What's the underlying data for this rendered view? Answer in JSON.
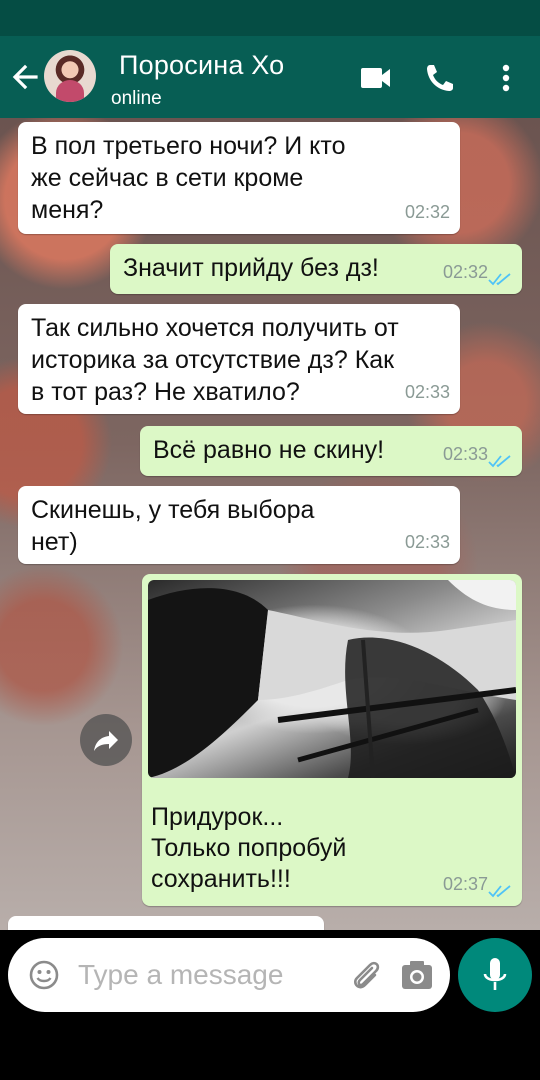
{
  "header": {
    "contact_name": "Поросина Хо",
    "status": "online",
    "back_icon": "arrow-left-icon",
    "actions": [
      "video-call-icon",
      "phone-icon",
      "more-vert-icon"
    ]
  },
  "messages": [
    {
      "direction": "incoming",
      "lines": [
        "В пол третьего ночи? И кто",
        "же сейчас в сети кроме",
        "меня?"
      ],
      "time": "02:32"
    },
    {
      "direction": "outgoing",
      "lines": [
        "Значит прийду без дз!"
      ],
      "time": "02:32",
      "read": true
    },
    {
      "direction": "incoming",
      "lines": [
        "Так сильно хочется получить от",
        "историка за отсутствие дз? Как",
        "в тот раз? Не хватило?"
      ],
      "time": "02:33"
    },
    {
      "direction": "outgoing",
      "lines": [
        "Всё равно не скину!"
      ],
      "time": "02:33",
      "read": true
    },
    {
      "direction": "incoming",
      "lines": [
        "Скинешь, у тебя выбора",
        "нет)"
      ],
      "time": "02:33"
    },
    {
      "direction": "outgoing",
      "has_photo": true,
      "lines": [
        "Придурок...",
        "Только попробуй",
        "сохранить!!!"
      ],
      "time": "02:37",
      "read": true
    }
  ],
  "composer": {
    "placeholder": "Type a message",
    "icons": [
      "emoji-icon",
      "attach-icon",
      "camera-icon",
      "mic-icon"
    ]
  },
  "colors": {
    "header": "#075e54",
    "statusbar": "#054d44",
    "outgoing_bubble": "#dcf8c6",
    "incoming_bubble": "#ffffff",
    "read_ticks": "#4fc3f7",
    "mic_button": "#00897b"
  }
}
